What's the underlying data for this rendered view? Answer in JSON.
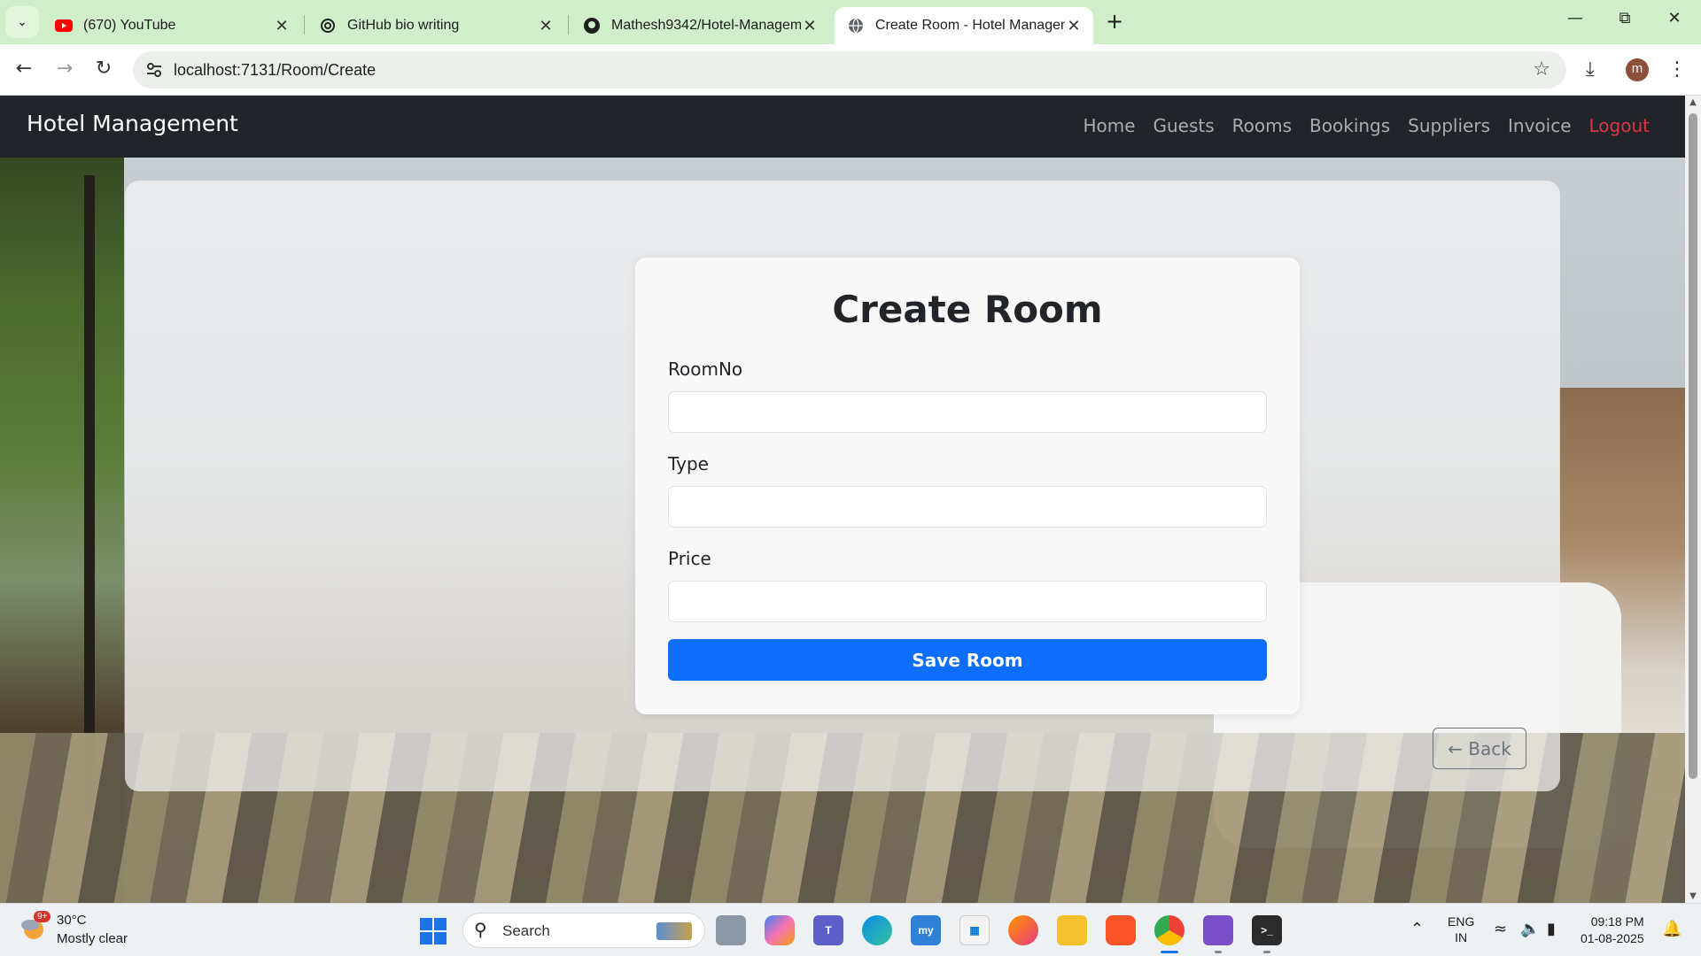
{
  "browser": {
    "tabs": [
      {
        "title": "(670) YouTube",
        "favicon": "youtube-icon",
        "active": false
      },
      {
        "title": "GitHub bio writing",
        "favicon": "openai-icon",
        "active": false
      },
      {
        "title": "Mathesh9342/Hotel-Managem",
        "favicon": "github-icon",
        "active": false
      },
      {
        "title": "Create Room - Hotel Managem",
        "favicon": "globe-icon",
        "active": true
      }
    ],
    "url": "localhost:7131/Room/Create",
    "profile_initial": "m"
  },
  "navbar": {
    "brand": "Hotel Management",
    "links": [
      "Home",
      "Guests",
      "Rooms",
      "Bookings",
      "Suppliers",
      "Invoice",
      "Logout"
    ]
  },
  "form": {
    "title": "Create Room",
    "fields": [
      {
        "label": "RoomNo",
        "value": ""
      },
      {
        "label": "Type",
        "value": ""
      },
      {
        "label": "Price",
        "value": ""
      }
    ],
    "submit_label": "Save Room",
    "back_label": "← Back"
  },
  "colors": {
    "navbar_bg": "#212529",
    "primary": "#0d6efd",
    "danger": "#dc3545",
    "secondary": "#6c757d",
    "tab_strip": "#cfeec9"
  },
  "taskbar": {
    "weather_badge": "9+",
    "weather_temp": "30°C",
    "weather_desc": "Mostly clear",
    "search_placeholder": "Search",
    "language_line1": "ENG",
    "language_line2": "IN",
    "time": "09:18 PM",
    "date": "01-08-2025"
  }
}
